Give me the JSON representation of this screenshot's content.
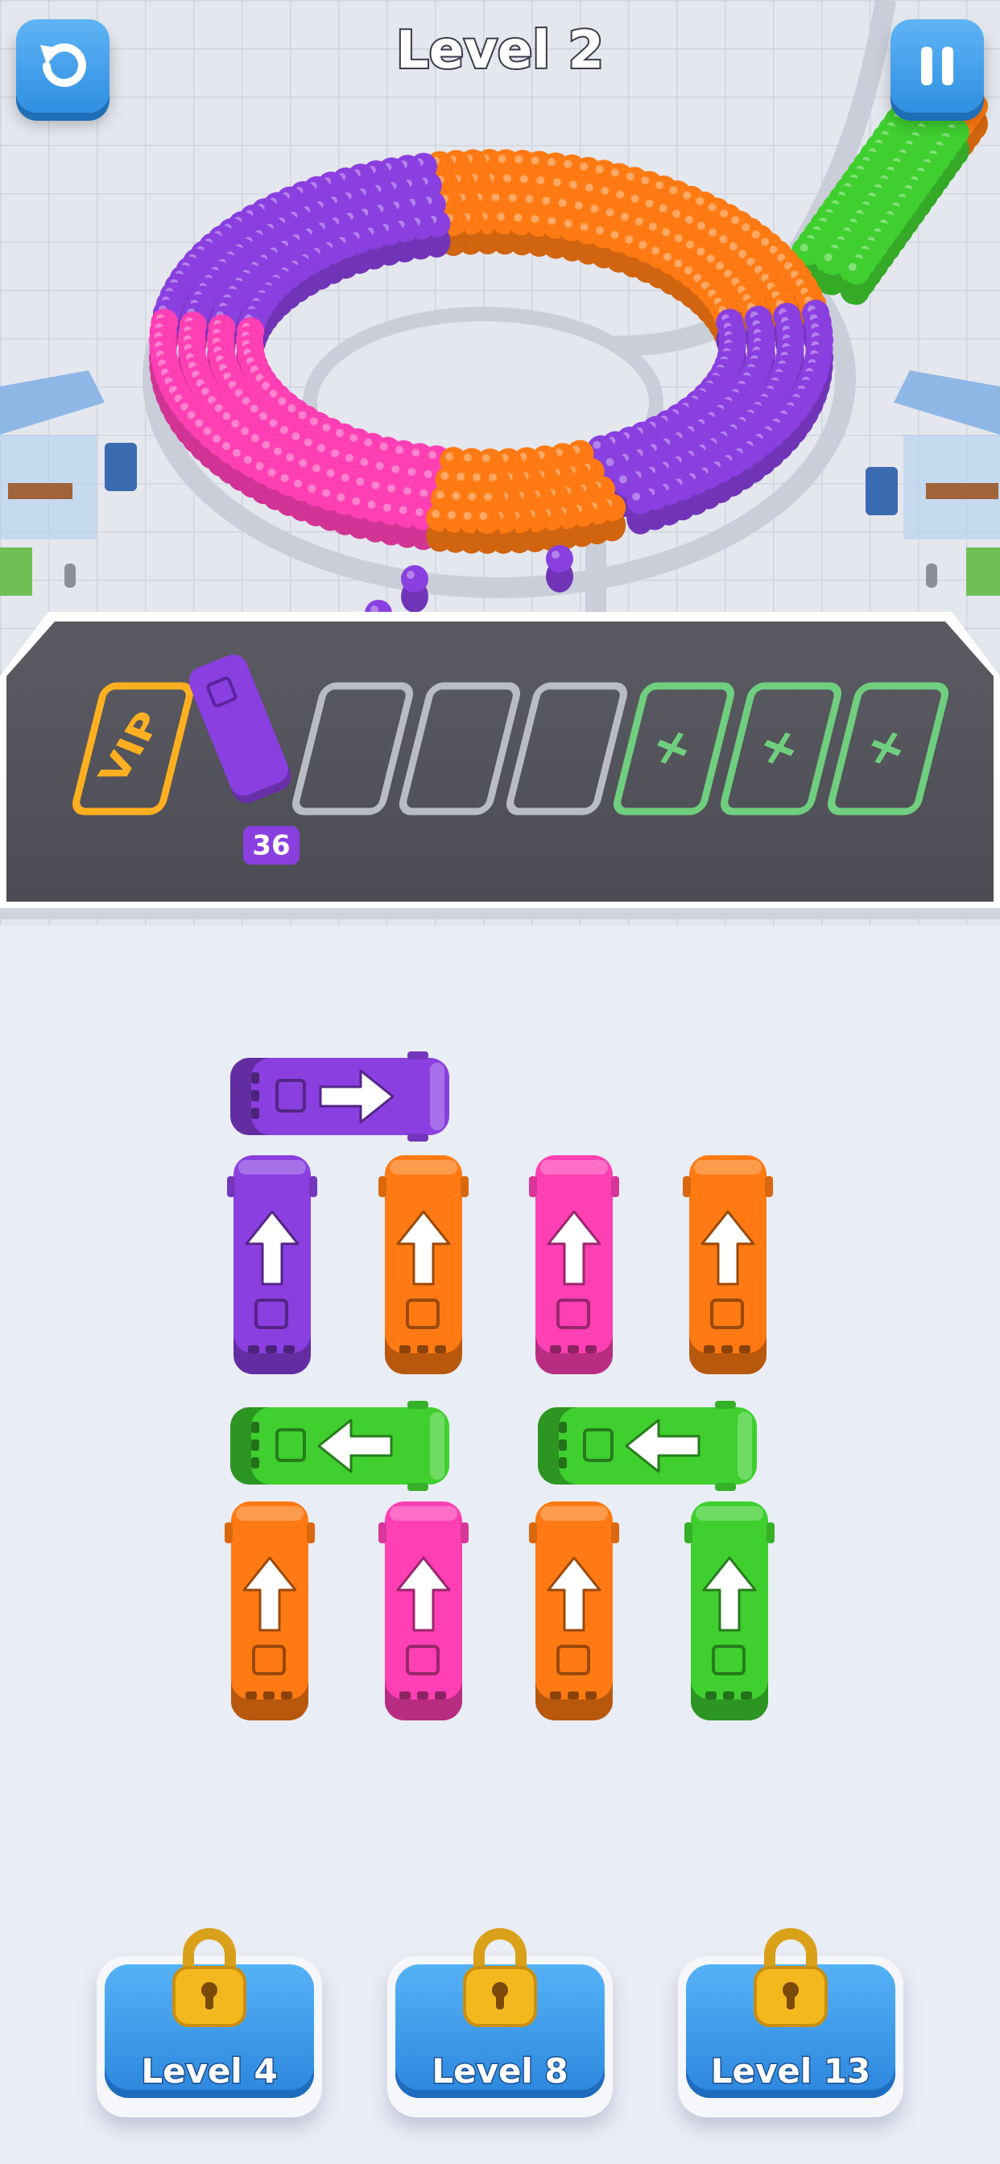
{
  "header": {
    "title": "Level 2",
    "undo_icon": "undo-arrow-icon",
    "pause_icon": "pause-icon"
  },
  "parking": {
    "vip_label": "VIP",
    "empty_slots": 3,
    "locked_slots": 3,
    "locked_slot_symbol": "+",
    "active_bus_color": "#8a3fe0",
    "active_bus_count": "36"
  },
  "colors": {
    "purple": "#8a3fe0",
    "orange": "#ff7a12",
    "pink": "#ff3fb4",
    "green": "#3fcf2f",
    "vip_gold": "#ffb020",
    "slot_green": "#6fcf7f",
    "button_blue": "#3a9ae8"
  },
  "buses": [
    {
      "id": "bus-1",
      "color": "purple",
      "direction": "right"
    },
    {
      "id": "bus-2",
      "color": "purple",
      "direction": "up"
    },
    {
      "id": "bus-3",
      "color": "orange",
      "direction": "up"
    },
    {
      "id": "bus-4",
      "color": "pink",
      "direction": "up"
    },
    {
      "id": "bus-5",
      "color": "orange",
      "direction": "up"
    },
    {
      "id": "bus-6",
      "color": "green",
      "direction": "left"
    },
    {
      "id": "bus-7",
      "color": "green",
      "direction": "left"
    },
    {
      "id": "bus-8",
      "color": "orange",
      "direction": "up"
    },
    {
      "id": "bus-9",
      "color": "pink",
      "direction": "up"
    },
    {
      "id": "bus-10",
      "color": "orange",
      "direction": "up"
    },
    {
      "id": "bus-11",
      "color": "green",
      "direction": "up"
    }
  ],
  "unlocks": [
    {
      "label": "Level 4",
      "icon": "padlock-icon"
    },
    {
      "label": "Level 8",
      "icon": "padlock-icon"
    },
    {
      "label": "Level 13",
      "icon": "padlock-icon"
    }
  ]
}
